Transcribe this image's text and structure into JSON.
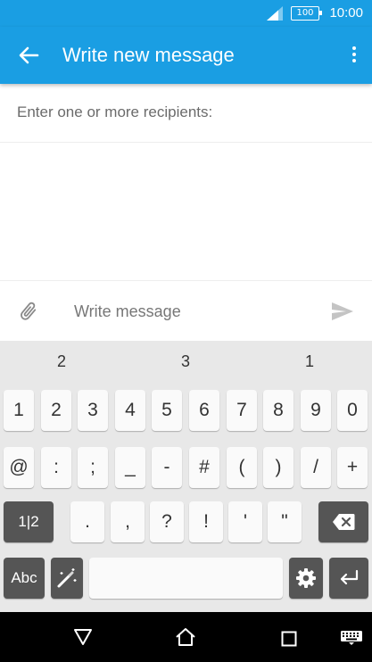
{
  "status": {
    "battery": "100",
    "time": "10:00"
  },
  "appbar": {
    "title": "Write new message",
    "back_icon": "arrow-back-icon",
    "more_icon": "more-vert-icon",
    "color": "#1a9ee3"
  },
  "recipient": {
    "placeholder": "Enter one or more recipients:"
  },
  "compose": {
    "placeholder": "Write message",
    "attach_icon": "paperclip-icon",
    "send_icon": "send-icon"
  },
  "keyboard": {
    "suggestions": [
      "2",
      "3",
      "1"
    ],
    "row1": [
      "1",
      "2",
      "3",
      "4",
      "5",
      "6",
      "7",
      "8",
      "9",
      "0"
    ],
    "row2": [
      "@",
      ":",
      ";",
      "_",
      "-",
      "#",
      "(",
      ")",
      "/",
      "+"
    ],
    "row3": [
      ".",
      ",",
      "?",
      "!",
      "'",
      "\""
    ],
    "mode_key": "1|2",
    "abc_key": "Abc"
  }
}
